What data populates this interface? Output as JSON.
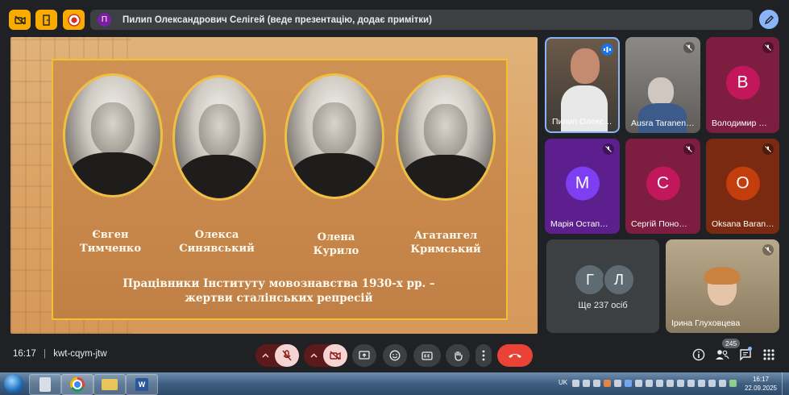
{
  "presenter_bar": {
    "avatar_letter": "П",
    "text": "Пилип Олександрович Селігей (веде презентацію, додає примітки)"
  },
  "slide": {
    "people": [
      {
        "line1": "Євген",
        "line2": "Тимченко"
      },
      {
        "line1": "Олекса",
        "line2": "Синявський"
      },
      {
        "line1": "Олена",
        "line2": "Курило"
      },
      {
        "line1": "Агатангел",
        "line2": "Кримський"
      }
    ],
    "caption_line1": "Працівники Інституту мовознавства 1930-х рр. –",
    "caption_line2": "жертви сталінських репресій"
  },
  "participants": [
    {
      "name": "Пилип Олекс…",
      "type": "video"
    },
    {
      "name": "Ausra Taranen…",
      "type": "video"
    },
    {
      "name": "Володимир …",
      "letter": "В",
      "tile_color": "#7d1d3f",
      "avatar_color": "#c2185b"
    },
    {
      "name": "Марія Остап…",
      "letter": "М",
      "tile_color": "#5e1f8e",
      "avatar_color": "#7e3ff2"
    },
    {
      "name": "Сергій Поно…",
      "letter": "С",
      "tile_color": "#7d1d3f",
      "avatar_color": "#c2185b"
    },
    {
      "name": "Oksana Baran…",
      "letter": "О",
      "tile_color": "#7a2a10",
      "avatar_color": "#c43d0c"
    },
    {
      "name": "Ірина Глуховцева",
      "type": "video"
    }
  ],
  "others": {
    "letters": [
      "Г",
      "Л"
    ],
    "label": "Ще 237 осіб"
  },
  "bottom": {
    "time": "16:17",
    "separator": "|",
    "meeting_code": "kwt-cqym-jtw",
    "people_count": "245"
  },
  "taskbar": {
    "lang": "UK",
    "clock_time": "16:17",
    "clock_date": "22.09.2025"
  },
  "colors": {
    "accent_blue": "#8ab4f8",
    "end_call_red": "#ea4335",
    "bar_bg": "#202124",
    "frame_yellow": "#f2c12e"
  }
}
